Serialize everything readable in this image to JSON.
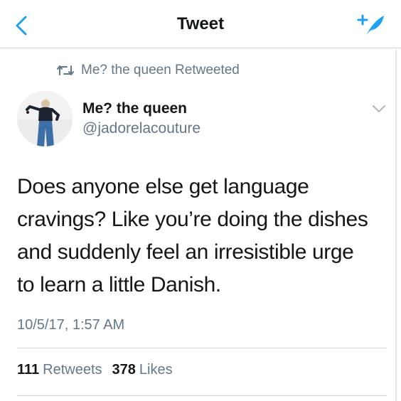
{
  "nav": {
    "title": "Tweet",
    "back_icon": "chevron-left-icon",
    "compose_icon": "compose-tweet-icon",
    "accent_color": "#1da1f2"
  },
  "retweet": {
    "icon": "retweet-icon",
    "text": "Me? the queen Retweeted"
  },
  "author": {
    "display_name": "Me? the queen",
    "handle": "@jadorelacouture"
  },
  "tweet": {
    "lines": [
      "Does anyone else get language",
      "cravings? Like you’re doing the dishes",
      "and suddenly feel an irresistible urge",
      "to learn a little Danish."
    ],
    "timestamp": "10/5/17, 1:57 AM"
  },
  "stats": {
    "retweets_count": "111",
    "retweets_label": "Retweets",
    "likes_count": "378",
    "likes_label": "Likes"
  },
  "colors": {
    "text_primary": "#14171a",
    "text_secondary": "#657786",
    "divider": "#d4d9dd"
  }
}
